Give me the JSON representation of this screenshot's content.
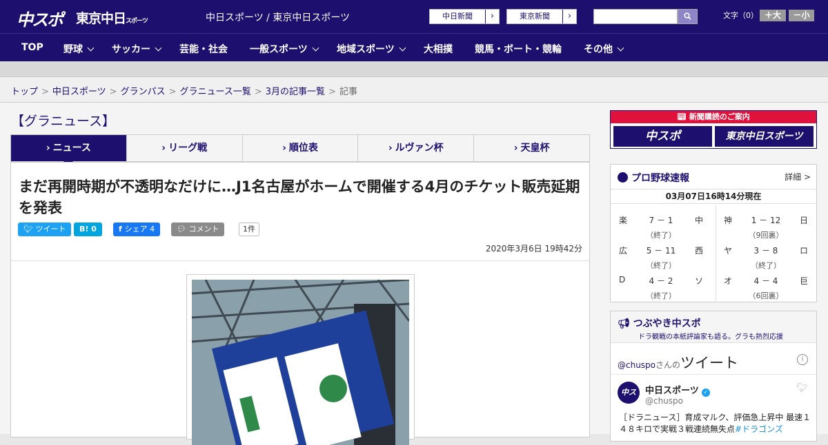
{
  "header": {
    "logo_chuspo": "中スポ",
    "logo_tokyo": "東京中日",
    "logo_tokyo_small": "スポーツ",
    "site_title": "中日スポーツ / 東京中日スポーツ",
    "link_chunichi": "中日新聞",
    "link_tokyo": "東京新聞",
    "search_placeholder": "",
    "fontsize_label": "文字（0）",
    "font_bigger": "＋大",
    "font_smaller": "－小"
  },
  "nav": [
    {
      "label": "TOP",
      "dropdown": false
    },
    {
      "label": "野球",
      "dropdown": true
    },
    {
      "label": "サッカー",
      "dropdown": true
    },
    {
      "label": "芸能・社会",
      "dropdown": false
    },
    {
      "label": "一般スポーツ",
      "dropdown": true
    },
    {
      "label": "地域スポーツ",
      "dropdown": true
    },
    {
      "label": "大相撲",
      "dropdown": false
    },
    {
      "label": "競馬・ボート・競輪",
      "dropdown": false
    },
    {
      "label": "その他",
      "dropdown": true
    }
  ],
  "breadcrumb": [
    "トップ",
    "中日スポーツ",
    "グランパス",
    "グラニュース一覧",
    "3月の記事一覧",
    "記事"
  ],
  "section_title": "【グラニュース】",
  "tabs": [
    "ニュース",
    "リーグ戦",
    "順位表",
    "ルヴァン杯",
    "天皇杯"
  ],
  "article": {
    "headline": "まだ再開時期が不透明なだけに…J1名古屋がホームで開催する4月のチケット販売延期を発表",
    "share_tweet": "ツイート",
    "share_hatena": "B! 0",
    "share_facebook": "シェア 4",
    "share_comment": "コメント",
    "comment_count": "1件",
    "date": "2020年3月6日 19時42分"
  },
  "sidebar": {
    "subscribe_header": "新聞購読のご案内",
    "subscribe_chuspo": "中スポ",
    "subscribe_tokyo": "東京中日スポーツ",
    "baseball_title": "プロ野球速報",
    "baseball_detail": "詳細 >",
    "baseball_time": "03月07日16時14分現在",
    "games": [
      {
        "home": "楽",
        "score": "7 － 1",
        "away": "中",
        "status": "（終了）"
      },
      {
        "home": "神",
        "score": "1 － 12",
        "away": "日",
        "status": "（9回裏）"
      },
      {
        "home": "広",
        "score": "5 － 11",
        "away": "西",
        "status": "（終了）"
      },
      {
        "home": "ヤ",
        "score": "3 － 8",
        "away": "ロ",
        "status": "（終了）"
      },
      {
        "home": "D",
        "score": "4 － 2",
        "away": "ソ",
        "status": "（終了）"
      },
      {
        "home": "オ",
        "score": "4 － 4",
        "away": "巨",
        "status": "（6回裏）"
      }
    ],
    "tweet_title": "つぶやき中スポ",
    "tweet_subtitle": "ドラ観戦の本紙評論家も語る。グラも熱烈応援",
    "tweet_handle_link": "@chuspo",
    "tweet_san": "さんの",
    "tweet_big": "ツイート",
    "tweet_author": "中日スポーツ",
    "tweet_author_handle": "@chuspo",
    "tweet_text": "［ドラニュース］育成マルク、評価急上昇中 最速１４８キロで実戦３戦連続無失点",
    "tweet_hashtag": "#ドラゴンズ"
  }
}
